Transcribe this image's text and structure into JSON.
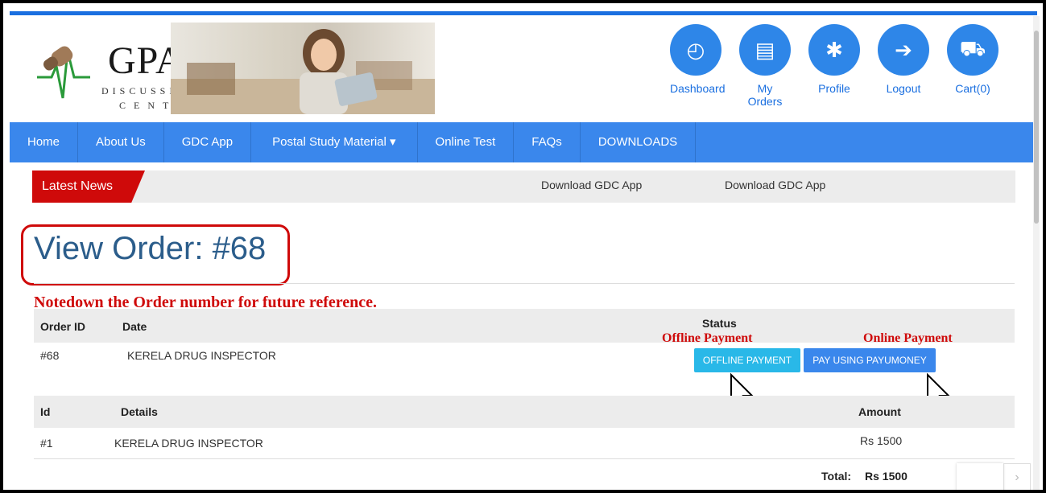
{
  "header": {
    "logo_title": "GPAT",
    "logo_sub1": "DISCUSSION",
    "logo_sub2": "CENTER",
    "nav_icons": [
      {
        "label": "Dashboard",
        "icon": "dashboard-icon"
      },
      {
        "label": "My Orders",
        "icon": "list-icon"
      },
      {
        "label": "Profile",
        "icon": "gear-icon"
      },
      {
        "label": "Logout",
        "icon": "logout-icon"
      },
      {
        "label": "Cart(0)",
        "icon": "cart-icon"
      }
    ]
  },
  "navbar": {
    "items": [
      "Home",
      "About Us",
      "GDC App",
      "Postal Study Material ▾",
      "Online Test",
      "FAQs",
      "DOWNLOADS"
    ]
  },
  "news": {
    "label": "Latest News",
    "items": [
      "Download GDC App",
      "Download GDC App"
    ]
  },
  "page": {
    "title": "View Order: #68",
    "note": "Notedown the Order number for future reference."
  },
  "order_table": {
    "headers": {
      "order_id": "Order ID",
      "date": "Date",
      "status": "Status"
    },
    "row": {
      "order_id": "#68",
      "date": "KERELA DRUG INSPECTOR"
    },
    "offline_annotation": "Offline Payment",
    "online_annotation": "Online Payment",
    "offline_button": "OFFLINE PAYMENT",
    "online_button": "PAY USING PAYUMONEY"
  },
  "items_table": {
    "headers": {
      "id": "Id",
      "details": "Details",
      "amount": "Amount"
    },
    "rows": [
      {
        "id": "#1",
        "details": "KERELA DRUG INSPECTOR",
        "amount": "Rs 1500"
      }
    ],
    "total_label": "Total:",
    "total_value": "Rs 1500"
  },
  "pager": {
    "next": "›"
  },
  "colors": {
    "accent": "#3a87ec",
    "red": "#cf0a0a",
    "offline": "#29b8e8"
  }
}
